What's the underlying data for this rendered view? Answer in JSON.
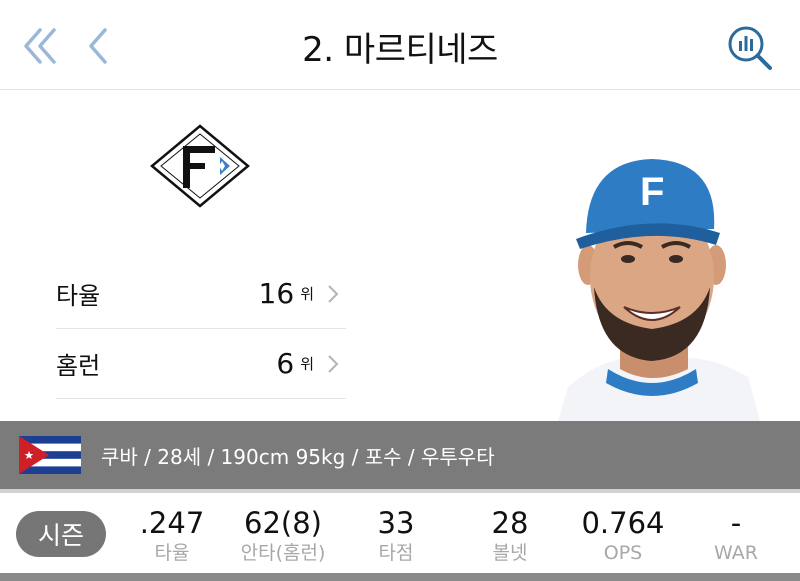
{
  "header": {
    "title": "2. 마르티네즈"
  },
  "colors": {
    "accent": "#9bb8d8",
    "search_icon": "#2a6b9c",
    "info_bar": "#7b7b7b",
    "season_button": "#767676"
  },
  "profile": {
    "team_logo_letter": "F",
    "ranks": [
      {
        "label": "타율",
        "value": "16",
        "unit": "위"
      },
      {
        "label": "홈런",
        "value": "6",
        "unit": "위"
      }
    ]
  },
  "info": {
    "flag": "cuba-flag",
    "text": "쿠바 / 28세 / 190cm 95kg / 포수 / 우투우타"
  },
  "stats": {
    "season_label": "시즌",
    "items": [
      {
        "value": ".247",
        "label": "타율"
      },
      {
        "value": "62(8)",
        "label": "안타(홈런)"
      },
      {
        "value": "33",
        "label": "타점"
      },
      {
        "value": "28",
        "label": "볼넷"
      },
      {
        "value": "0.764",
        "label": "OPS"
      },
      {
        "value": "-",
        "label": "WAR"
      }
    ]
  }
}
